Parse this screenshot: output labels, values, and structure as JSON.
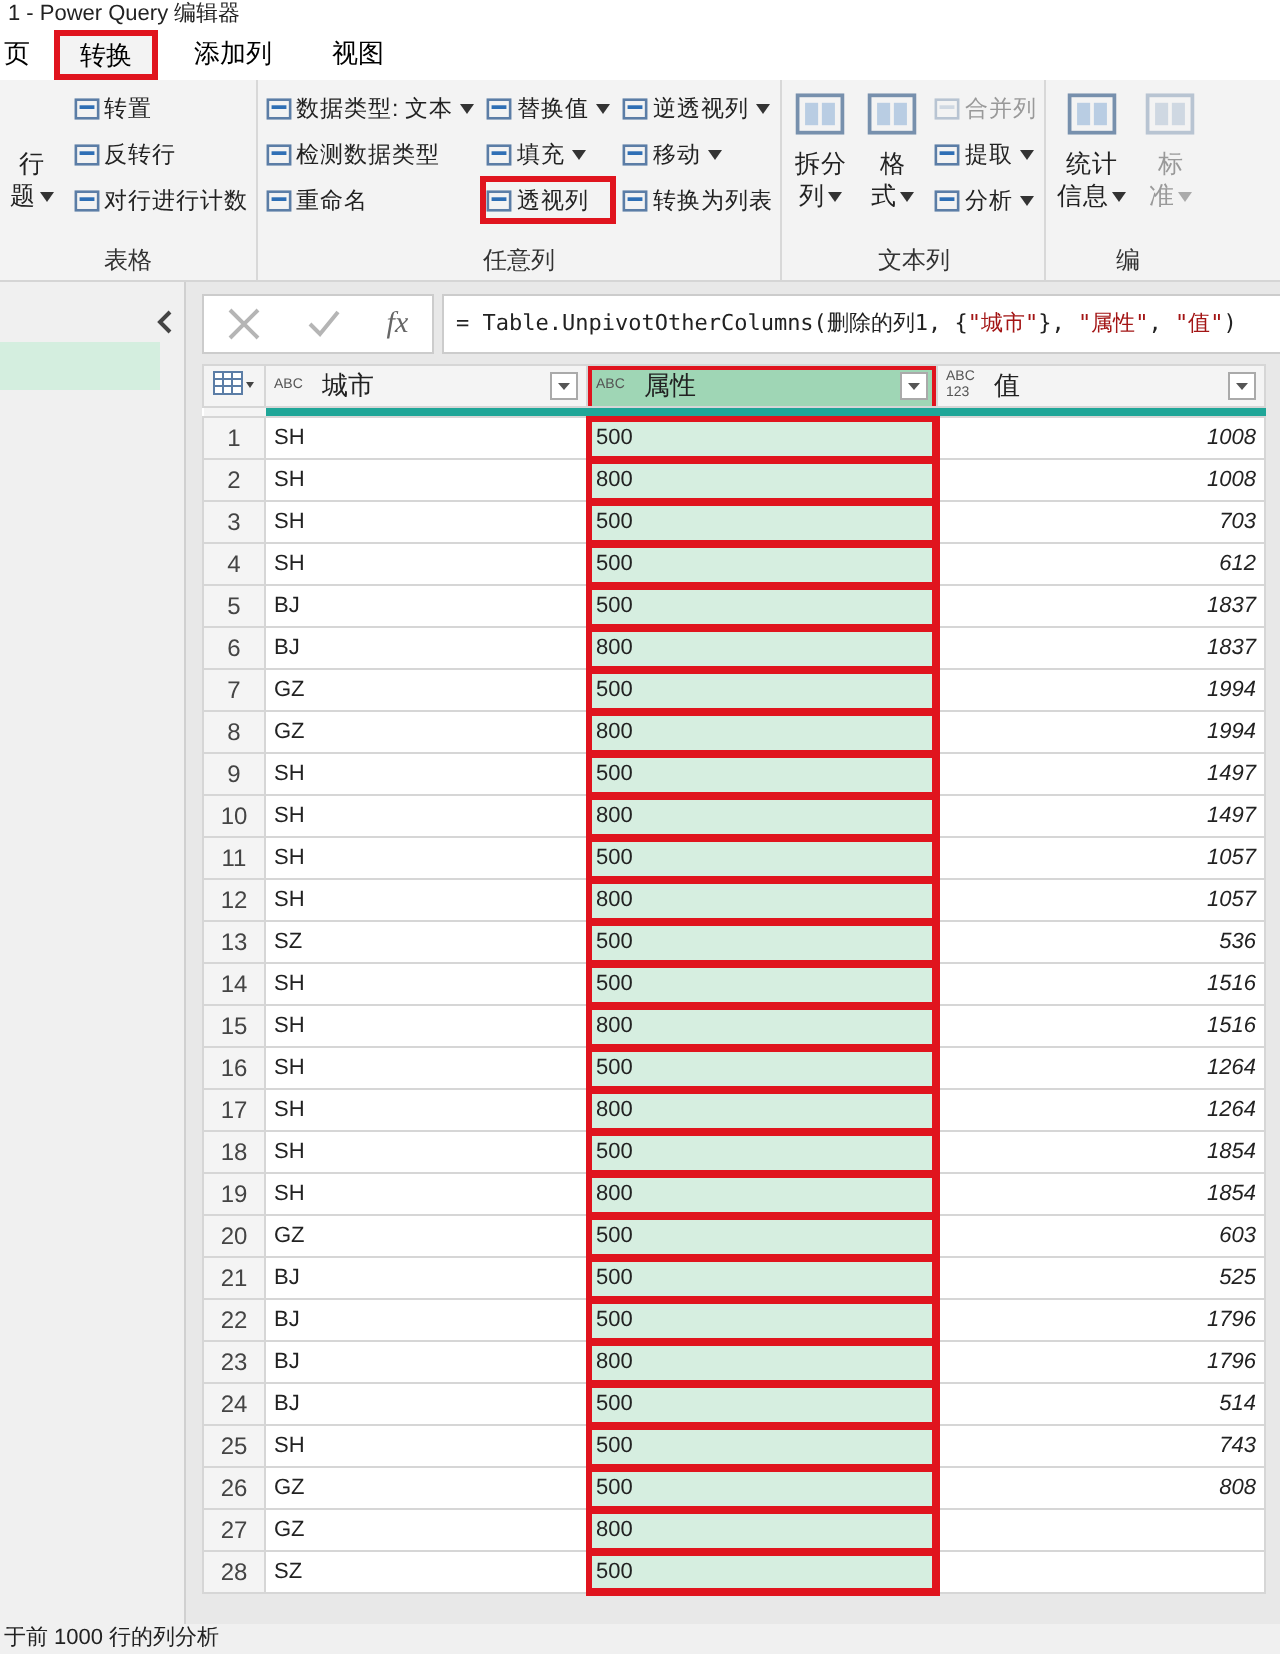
{
  "window": {
    "title": "1 - Power Query 编辑器"
  },
  "tabs": [
    {
      "label": "页",
      "selected": false,
      "highlighted": false
    },
    {
      "label": "转换",
      "selected": true,
      "highlighted": true
    },
    {
      "label": "添加列",
      "selected": false,
      "highlighted": false
    },
    {
      "label": "视图",
      "selected": false,
      "highlighted": false
    }
  ],
  "ribbon": [
    {
      "label": "表格",
      "columns": [
        [
          {
            "kind": "large",
            "lines": [
              "行",
              "题"
            ],
            "dropdown": true,
            "disabled": false,
            "highlighted": false
          }
        ],
        [
          {
            "kind": "small",
            "label": "转置",
            "dropdown": false,
            "disabled": false,
            "highlighted": false
          },
          {
            "kind": "small",
            "label": "反转行",
            "dropdown": false,
            "disabled": false,
            "highlighted": false
          },
          {
            "kind": "small",
            "label": "对行进行计数",
            "dropdown": false,
            "disabled": false,
            "highlighted": false
          }
        ]
      ]
    },
    {
      "label": "任意列",
      "columns": [
        [
          {
            "kind": "small",
            "label": "数据类型: 文本",
            "dropdown": true,
            "disabled": false,
            "highlighted": false
          },
          {
            "kind": "small",
            "label": "检测数据类型",
            "dropdown": false,
            "disabled": false,
            "highlighted": false
          },
          {
            "kind": "small",
            "label": "重命名",
            "dropdown": false,
            "disabled": false,
            "highlighted": false
          }
        ],
        [
          {
            "kind": "small",
            "label": "替换值",
            "dropdown": true,
            "disabled": false,
            "highlighted": false
          },
          {
            "kind": "small",
            "label": "填充",
            "dropdown": true,
            "disabled": false,
            "highlighted": false
          },
          {
            "kind": "small",
            "label": "透视列",
            "dropdown": false,
            "disabled": false,
            "highlighted": true
          }
        ],
        [
          {
            "kind": "small",
            "label": "逆透视列",
            "dropdown": true,
            "disabled": false,
            "highlighted": false
          },
          {
            "kind": "small",
            "label": "移动",
            "dropdown": true,
            "disabled": false,
            "highlighted": false
          },
          {
            "kind": "small",
            "label": "转换为列表",
            "dropdown": false,
            "disabled": false,
            "highlighted": false
          }
        ]
      ]
    },
    {
      "label": "文本列",
      "columns": [
        [
          {
            "kind": "large",
            "lines": [
              "拆分",
              "列"
            ],
            "dropdown": true,
            "disabled": false,
            "highlighted": false
          }
        ],
        [
          {
            "kind": "large",
            "lines": [
              "格",
              "式"
            ],
            "dropdown": true,
            "disabled": false,
            "highlighted": false
          }
        ],
        [
          {
            "kind": "small",
            "label": "合并列",
            "dropdown": false,
            "disabled": true,
            "highlighted": false
          },
          {
            "kind": "small",
            "label": "提取",
            "dropdown": true,
            "disabled": false,
            "highlighted": false
          },
          {
            "kind": "small",
            "label": "分析",
            "dropdown": true,
            "disabled": false,
            "highlighted": false
          }
        ]
      ]
    },
    {
      "label": "编",
      "columns": [
        [
          {
            "kind": "large",
            "lines": [
              "统计",
              "信息"
            ],
            "dropdown": true,
            "disabled": false,
            "highlighted": false
          }
        ],
        [
          {
            "kind": "large",
            "lines": [
              "标",
              "准"
            ],
            "dropdown": true,
            "disabled": true,
            "highlighted": false
          }
        ]
      ]
    }
  ],
  "formula_button": "fx",
  "formula": [
    {
      "kind": "code",
      "text": "= Table.UnpivotOtherColumns(删除的列1, {"
    },
    {
      "kind": "string",
      "text": "\"城市\""
    },
    {
      "kind": "code",
      "text": "}, "
    },
    {
      "kind": "string",
      "text": "\"属性\""
    },
    {
      "kind": "code",
      "text": ", "
    },
    {
      "kind": "string",
      "text": "\"值\""
    },
    {
      "kind": "code",
      "text": ")"
    }
  ],
  "table": {
    "columns": [
      {
        "name": "城市",
        "kind": "text",
        "type_label": "ABC",
        "selected": false,
        "highlighted": false
      },
      {
        "name": "属性",
        "kind": "text",
        "type_label": "ABC",
        "selected": true,
        "highlighted": true
      },
      {
        "name": "值",
        "kind": "any",
        "type_label": "ABC 123",
        "selected": false,
        "highlighted": false
      }
    ],
    "rows": [
      {
        "number": "1",
        "cells": [
          "SH",
          "500",
          "1008"
        ]
      },
      {
        "number": "2",
        "cells": [
          "SH",
          "800",
          "1008"
        ]
      },
      {
        "number": "3",
        "cells": [
          "SH",
          "500",
          "703"
        ]
      },
      {
        "number": "4",
        "cells": [
          "SH",
          "500",
          "612"
        ]
      },
      {
        "number": "5",
        "cells": [
          "BJ",
          "500",
          "1837"
        ]
      },
      {
        "number": "6",
        "cells": [
          "BJ",
          "800",
          "1837"
        ]
      },
      {
        "number": "7",
        "cells": [
          "GZ",
          "500",
          "1994"
        ]
      },
      {
        "number": "8",
        "cells": [
          "GZ",
          "800",
          "1994"
        ]
      },
      {
        "number": "9",
        "cells": [
          "SH",
          "500",
          "1497"
        ]
      },
      {
        "number": "10",
        "cells": [
          "SH",
          "800",
          "1497"
        ]
      },
      {
        "number": "11",
        "cells": [
          "SH",
          "500",
          "1057"
        ]
      },
      {
        "number": "12",
        "cells": [
          "SH",
          "800",
          "1057"
        ]
      },
      {
        "number": "13",
        "cells": [
          "SZ",
          "500",
          "536"
        ]
      },
      {
        "number": "14",
        "cells": [
          "SH",
          "500",
          "1516"
        ]
      },
      {
        "number": "15",
        "cells": [
          "SH",
          "800",
          "1516"
        ]
      },
      {
        "number": "16",
        "cells": [
          "SH",
          "500",
          "1264"
        ]
      },
      {
        "number": "17",
        "cells": [
          "SH",
          "800",
          "1264"
        ]
      },
      {
        "number": "18",
        "cells": [
          "SH",
          "500",
          "1854"
        ]
      },
      {
        "number": "19",
        "cells": [
          "SH",
          "800",
          "1854"
        ]
      },
      {
        "number": "20",
        "cells": [
          "GZ",
          "500",
          "603"
        ]
      },
      {
        "number": "21",
        "cells": [
          "BJ",
          "500",
          "525"
        ]
      },
      {
        "number": "22",
        "cells": [
          "BJ",
          "500",
          "1796"
        ]
      },
      {
        "number": "23",
        "cells": [
          "BJ",
          "800",
          "1796"
        ]
      },
      {
        "number": "24",
        "cells": [
          "BJ",
          "500",
          "514"
        ]
      },
      {
        "number": "25",
        "cells": [
          "SH",
          "500",
          "743"
        ]
      },
      {
        "number": "26",
        "cells": [
          "GZ",
          "500",
          "808"
        ]
      },
      {
        "number": "27",
        "cells": [
          "GZ",
          "800",
          ""
        ]
      },
      {
        "number": "28",
        "cells": [
          "SZ",
          "500",
          ""
        ]
      }
    ]
  },
  "status_bar": "于前 1000 行的列分析"
}
